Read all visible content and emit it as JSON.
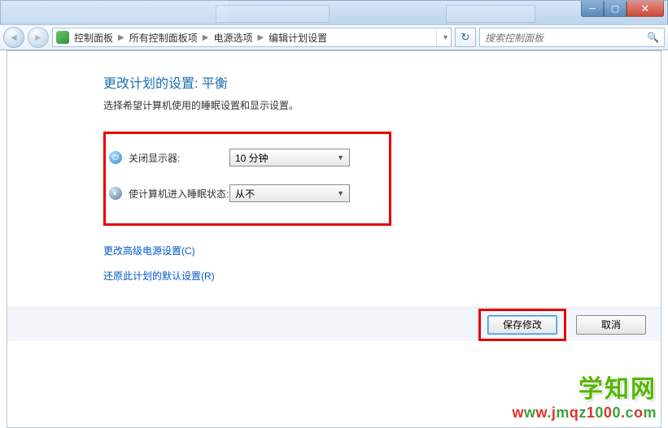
{
  "window": {
    "min_tip": "Minimize",
    "max_tip": "Maximize",
    "close_tip": "Close"
  },
  "breadcrumb": {
    "items": [
      "控制面板",
      "所有控制面板项",
      "电源选项",
      "编辑计划设置"
    ]
  },
  "search": {
    "placeholder": "搜索控制面板"
  },
  "page": {
    "title": "更改计划的设置: 平衡",
    "subtitle": "选择希望计算机使用的睡眠设置和显示设置。"
  },
  "settings": {
    "display_off": {
      "label": "关闭显示器:",
      "value": "10 分钟"
    },
    "sleep": {
      "label": "使计算机进入睡眠状态:",
      "value": "从不"
    }
  },
  "links": {
    "advanced": "更改高级电源设置(C)",
    "restore": "还原此计划的默认设置(R)"
  },
  "buttons": {
    "save": "保存修改",
    "cancel": "取消"
  },
  "watermark": {
    "line1": "学知网",
    "line2": "www.jmqz1000.com"
  }
}
